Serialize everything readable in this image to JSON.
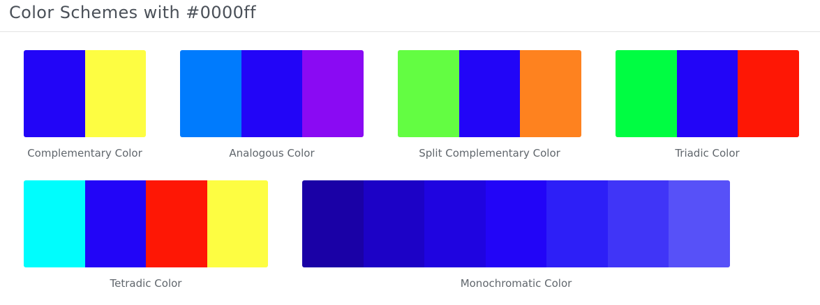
{
  "title": "Color Schemes with #0000ff",
  "schemes": [
    {
      "label": "Complementary Color",
      "colors": [
        "#2205f7",
        "#fdfd42"
      ]
    },
    {
      "label": "Analogous Color",
      "colors": [
        "#007bfd",
        "#2205f7",
        "#8a0af3"
      ]
    },
    {
      "label": "Split Complementary Color",
      "colors": [
        "#63fd42",
        "#2205f7",
        "#fe821f"
      ]
    },
    {
      "label": "Triadic Color",
      "colors": [
        "#00fd42",
        "#2205f7",
        "#fe1705"
      ]
    },
    {
      "label": "Tetradic Color",
      "colors": [
        "#00fdfd",
        "#2205f7",
        "#fe1705",
        "#fdfd42"
      ]
    },
    {
      "label": "Monochromatic Color",
      "colors": [
        "#1a01a6",
        "#1c02c6",
        "#1f04e0",
        "#2205f7",
        "#2d1ff7",
        "#4035f7",
        "#5751f8"
      ]
    }
  ]
}
